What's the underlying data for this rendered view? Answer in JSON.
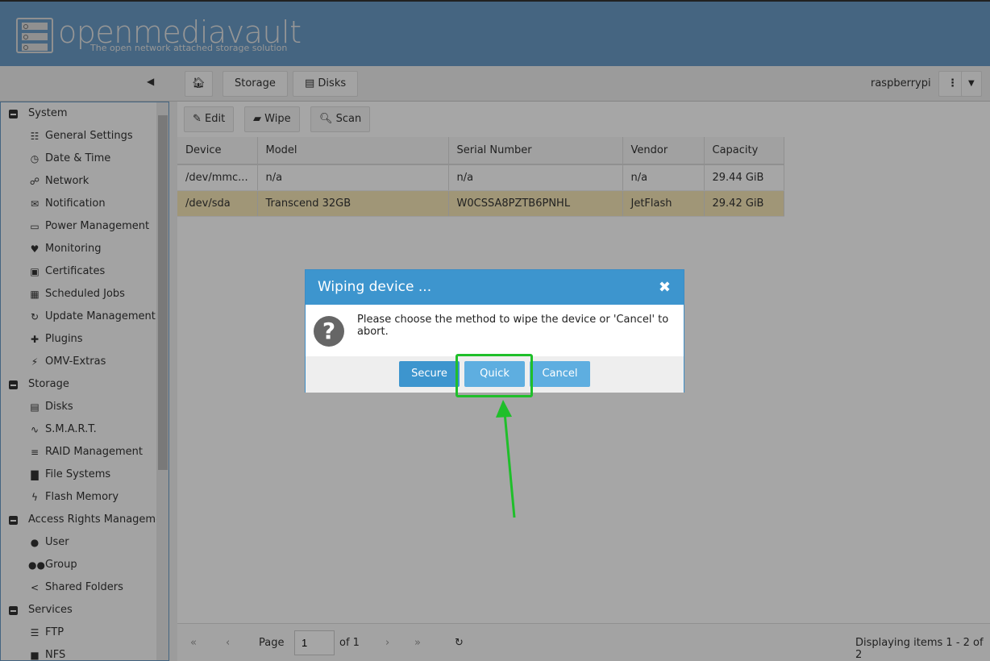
{
  "header": {
    "brand": "openmediavault",
    "tagline": "The open network attached storage solution"
  },
  "breadcrumb": {
    "items": [
      "Storage",
      "Disks"
    ],
    "hostname": "raspberrypi"
  },
  "toolbar": {
    "edit": "Edit",
    "wipe": "Wipe",
    "scan": "Scan"
  },
  "sidebar": [
    {
      "type": "g",
      "label": "System"
    },
    {
      "type": "c",
      "icon": "☷",
      "label": "General Settings"
    },
    {
      "type": "c",
      "icon": "◷",
      "label": "Date & Time"
    },
    {
      "type": "c",
      "icon": "☍",
      "label": "Network"
    },
    {
      "type": "c",
      "icon": "✉",
      "label": "Notification"
    },
    {
      "type": "c",
      "icon": "▭",
      "label": "Power Management"
    },
    {
      "type": "c",
      "icon": "♥",
      "label": "Monitoring"
    },
    {
      "type": "c",
      "icon": "▣",
      "label": "Certificates"
    },
    {
      "type": "c",
      "icon": "▦",
      "label": "Scheduled Jobs"
    },
    {
      "type": "c",
      "icon": "↻",
      "label": "Update Management"
    },
    {
      "type": "c",
      "icon": "✚",
      "label": "Plugins"
    },
    {
      "type": "c",
      "icon": "⚡",
      "label": "OMV-Extras"
    },
    {
      "type": "g",
      "label": "Storage"
    },
    {
      "type": "c",
      "icon": "▤",
      "label": "Disks"
    },
    {
      "type": "c",
      "icon": "∿",
      "label": "S.M.A.R.T."
    },
    {
      "type": "c",
      "icon": "≡",
      "label": "RAID Management"
    },
    {
      "type": "c",
      "icon": "▇",
      "label": "File Systems"
    },
    {
      "type": "c",
      "icon": "ϟ",
      "label": "Flash Memory"
    },
    {
      "type": "g",
      "label": "Access Rights Management"
    },
    {
      "type": "c",
      "icon": "●",
      "label": "User"
    },
    {
      "type": "c",
      "icon": "●●",
      "label": "Group"
    },
    {
      "type": "c",
      "icon": "<",
      "label": "Shared Folders"
    },
    {
      "type": "g",
      "label": "Services"
    },
    {
      "type": "c",
      "icon": "☰",
      "label": "FTP"
    },
    {
      "type": "c",
      "icon": "■",
      "label": "NFS"
    }
  ],
  "table": {
    "columns": [
      "Device",
      "Model",
      "Serial Number",
      "Vendor",
      "Capacity"
    ],
    "rows": [
      [
        "/dev/mmc...",
        "n/a",
        "n/a",
        "n/a",
        "29.44 GiB"
      ],
      [
        "/dev/sda",
        "Transcend 32GB",
        "W0CSSA8PZTB6PNHL",
        "JetFlash",
        "29.42 GiB"
      ]
    ]
  },
  "pager": {
    "page_label": "Page",
    "page": "1",
    "of": "of 1",
    "display": "Displaying items 1 - 2 of 2"
  },
  "dialog": {
    "title": "Wiping device ...",
    "message": "Please choose the method to wipe the device or 'Cancel' to abort.",
    "secure": "Secure",
    "quick": "Quick",
    "cancel": "Cancel"
  }
}
